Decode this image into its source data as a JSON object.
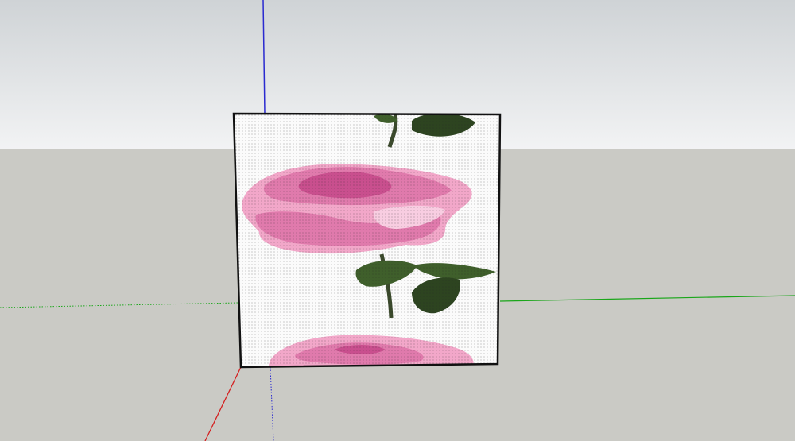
{
  "scene": {
    "sky_top_color": "#cfd3d6",
    "sky_bottom_color": "#f2f3f4",
    "ground_color": "#cacac5",
    "axis_colors": {
      "red": "#d42020",
      "green": "#1aa61a",
      "blue": "#2a2ad0"
    },
    "panel": {
      "face_color": "#fbfbfb",
      "edge_color": "#111111",
      "texture": "pink-rose",
      "petal_colors": [
        "#f2a7c9",
        "#e07aac",
        "#c94f8e",
        "#f8cde1"
      ],
      "leaf_color": "#3f5f2b",
      "leaf_dark_color": "#2d4420",
      "stem_color": "#3b4a2c"
    }
  }
}
